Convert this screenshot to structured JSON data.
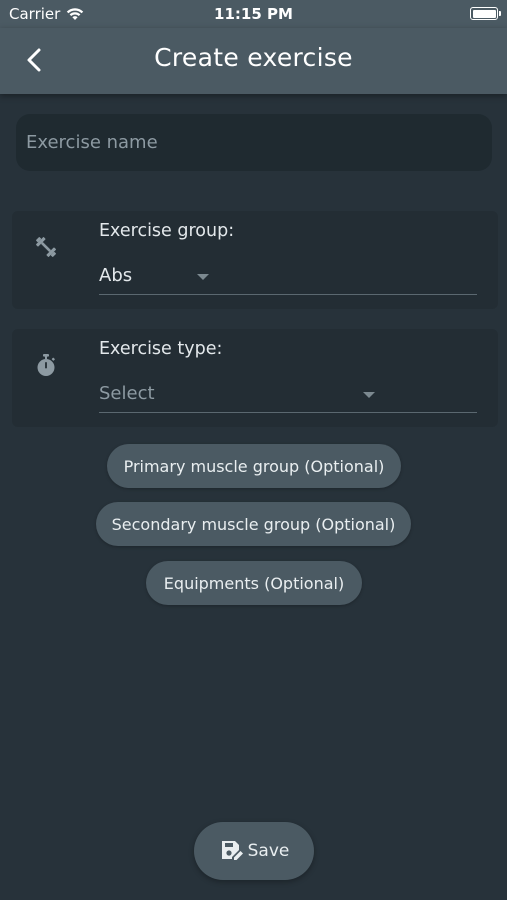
{
  "status_bar": {
    "carrier": "Carrier",
    "time": "11:15 PM"
  },
  "header": {
    "title": "Create exercise",
    "back_icon": "chevron-left-icon"
  },
  "exercise_name": {
    "placeholder": "Exercise name",
    "value": ""
  },
  "exercise_group": {
    "icon": "dumbbell-icon",
    "label": "Exercise group:",
    "value": "Abs"
  },
  "exercise_type": {
    "icon": "stopwatch-icon",
    "label": "Exercise type:",
    "value": "Select"
  },
  "optional_buttons": [
    {
      "label": "Primary muscle group (Optional)"
    },
    {
      "label": "Secondary muscle group (Optional)"
    },
    {
      "label": "Equipments (Optional)"
    }
  ],
  "save_button": {
    "label": "Save",
    "icon": "save-edit-icon"
  },
  "colors": {
    "background": "#27323a",
    "header": "#4b5a63",
    "card": "#232d34",
    "pill": "#4b5a63"
  }
}
